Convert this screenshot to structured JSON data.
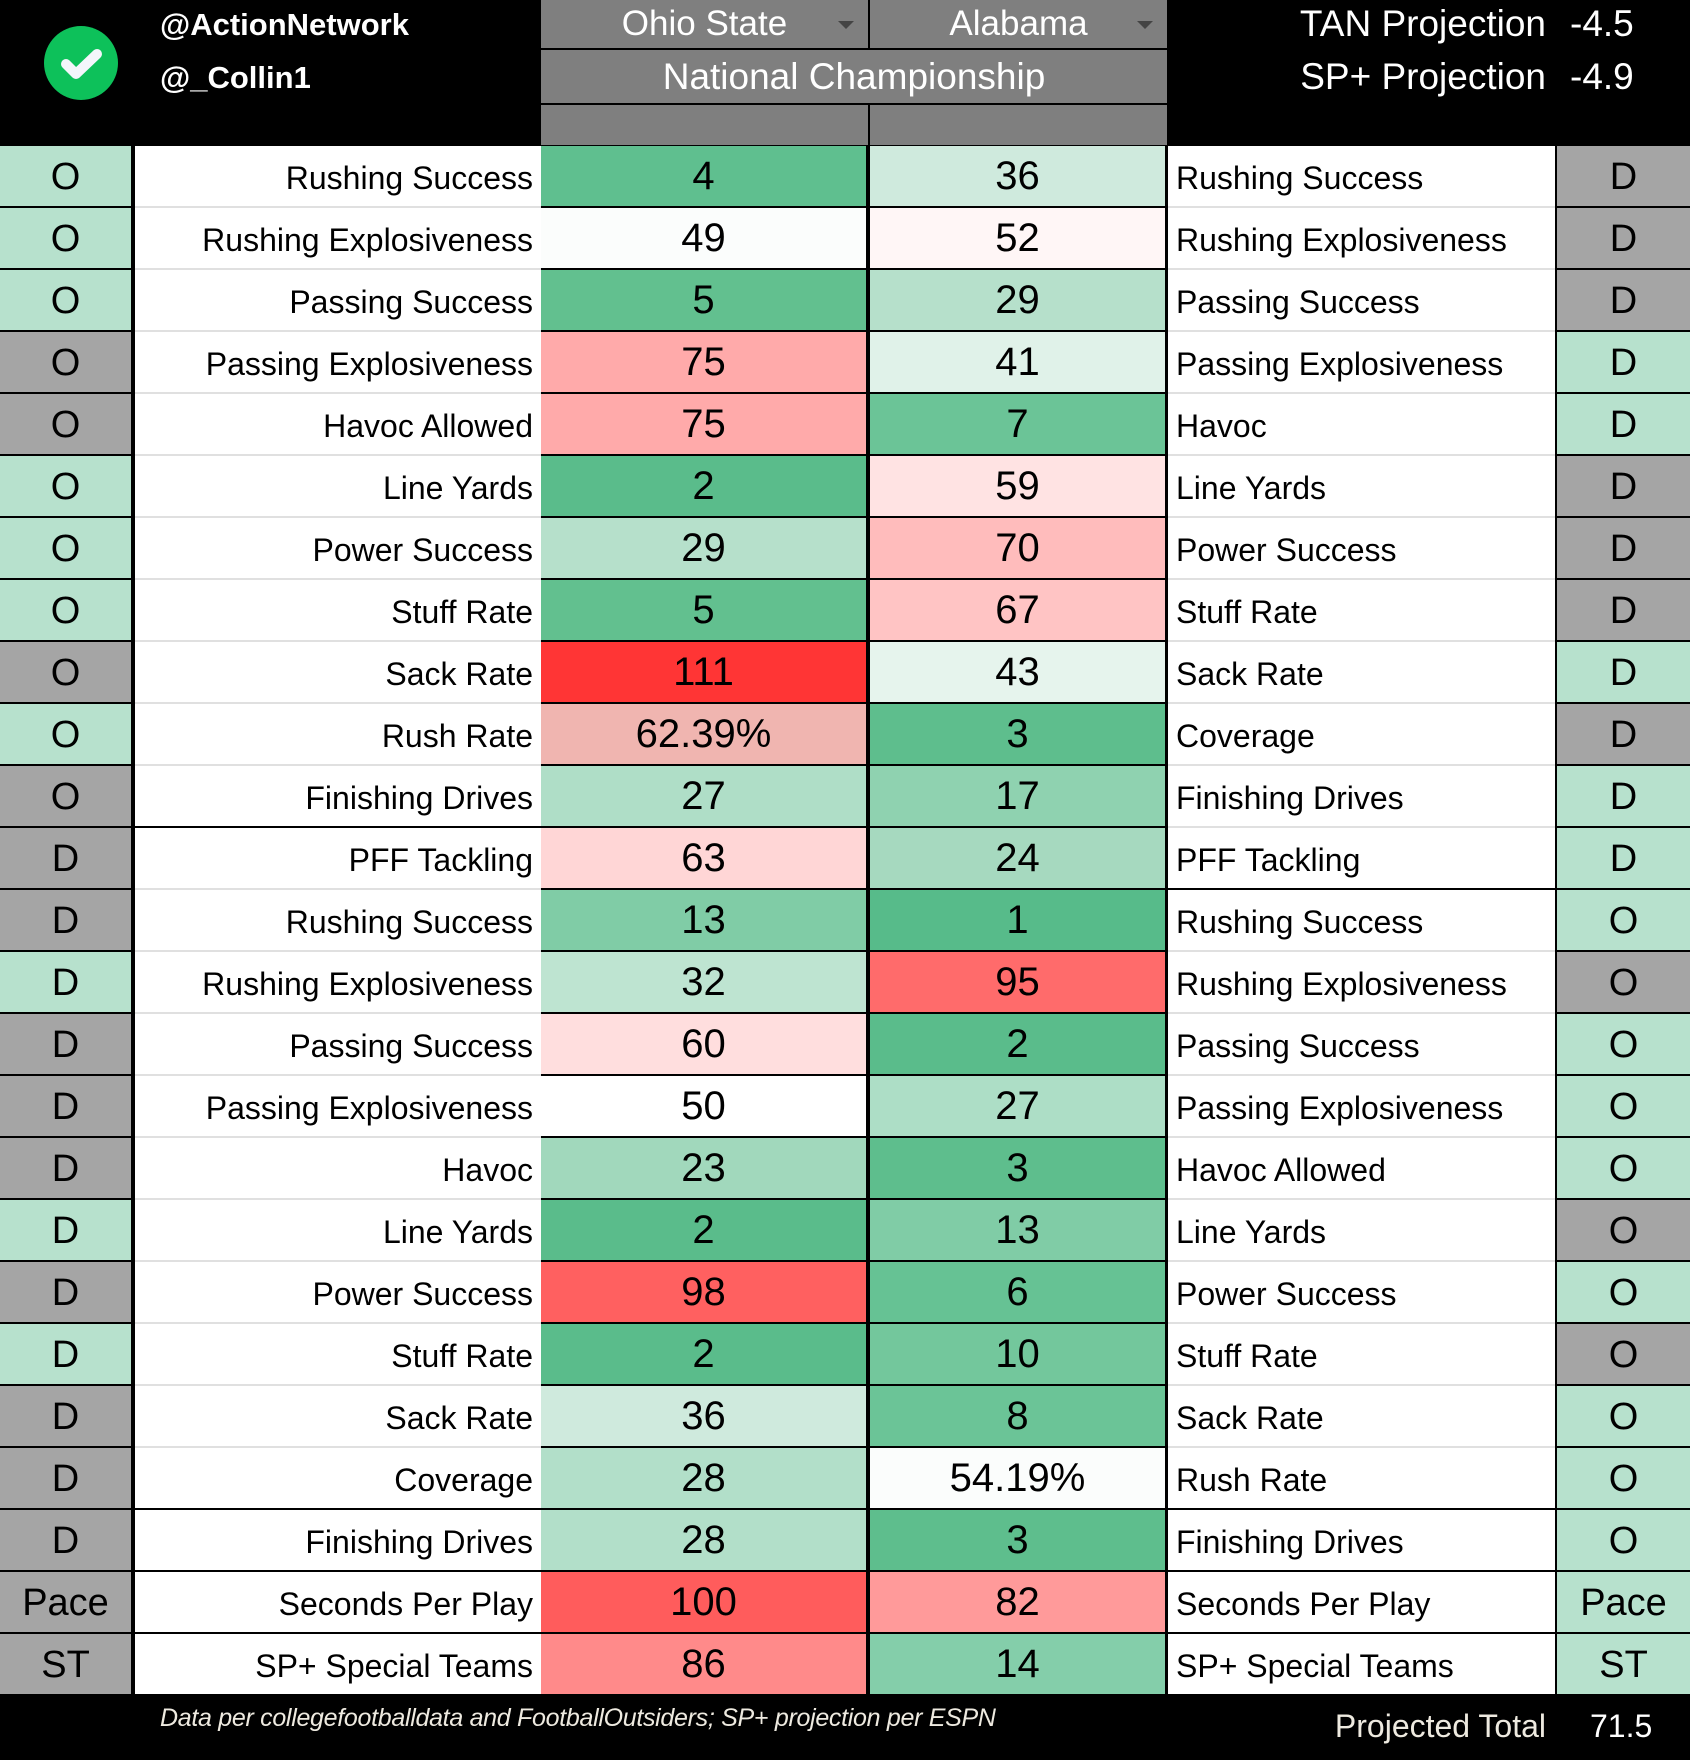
{
  "header": {
    "handles": [
      "@ActionNetwork",
      "@_Collin1"
    ],
    "badge_icon": "check-circle-icon",
    "team_a": "Ohio State",
    "team_b": "Alabama",
    "game": "National Championship",
    "projections": [
      {
        "label": "TAN Projection",
        "value": "-4.5"
      },
      {
        "label": "SP+ Projection",
        "value": "-4.9"
      }
    ]
  },
  "colors": {
    "side_green": "#b7e1cd",
    "side_gray": "#a5a5a5",
    "header_gray": "#7f7f7f",
    "badge_green": "#0dc15a"
  },
  "rows": [
    {
      "ls": "O",
      "lsc": "g",
      "lm": "Rushing Success",
      "a": "4",
      "ac": "#5fbf8f",
      "b": "36",
      "bc": "#cfeadd",
      "rm": "Rushing Success",
      "rs": "D",
      "rsc": "x"
    },
    {
      "ls": "O",
      "lsc": "g",
      "lm": "Rushing Explosiveness",
      "a": "49",
      "ac": "#fbfdfc",
      "b": "52",
      "bc": "#fff6f6",
      "rm": "Rushing Explosiveness",
      "rs": "D",
      "rsc": "x"
    },
    {
      "ls": "O",
      "lsc": "g",
      "lm": "Passing Success",
      "a": "5",
      "ac": "#62c08f",
      "b": "29",
      "bc": "#b6e0cb",
      "rm": "Passing Success",
      "rs": "D",
      "rsc": "x"
    },
    {
      "ls": "O",
      "lsc": "x",
      "lm": "Passing Explosiveness",
      "a": "75",
      "ac": "#ffaaaa",
      "b": "41",
      "bc": "#e0f2e9",
      "rm": "Passing Explosiveness",
      "rs": "D",
      "rsc": "g"
    },
    {
      "ls": "O",
      "lsc": "x",
      "lm": "Havoc Allowed",
      "a": "75",
      "ac": "#ffaaaa",
      "b": "7",
      "bc": "#6bc497",
      "rm": "Havoc",
      "rs": "D",
      "rsc": "g"
    },
    {
      "ls": "O",
      "lsc": "g",
      "lm": "Line Yards",
      "a": "2",
      "ac": "#5abc8b",
      "b": "59",
      "bc": "#ffe3e3",
      "rm": "Line Yards",
      "rs": "D",
      "rsc": "x"
    },
    {
      "ls": "O",
      "lsc": "g",
      "lm": "Power Success",
      "a": "29",
      "ac": "#b6e0cb",
      "b": "70",
      "bc": "#ffbcbc",
      "rm": "Power Success",
      "rs": "D",
      "rsc": "x"
    },
    {
      "ls": "O",
      "lsc": "g",
      "lm": "Stuff Rate",
      "a": "5",
      "ac": "#62c08f",
      "b": "67",
      "bc": "#ffc4c4",
      "rm": "Stuff Rate",
      "rs": "D",
      "rsc": "x"
    },
    {
      "ls": "O",
      "lsc": "x",
      "lm": "Sack Rate",
      "a": "111",
      "ac": "#ff3535",
      "b": "43",
      "bc": "#e6f4ed",
      "rm": "Sack Rate",
      "rs": "D",
      "rsc": "g"
    },
    {
      "ls": "O",
      "lsc": "g",
      "lm": "Rush Rate",
      "a": "62.39%",
      "ac": "#f0b5b0",
      "b": "3",
      "bc": "#5ebe8d",
      "rm": "Coverage",
      "rs": "D",
      "rsc": "x"
    },
    {
      "ls": "O",
      "lsc": "x",
      "lm": "Finishing Drives",
      "a": "27",
      "ac": "#afdec7",
      "b": "17",
      "bc": "#8fd2b0",
      "rm": "Finishing Drives",
      "rs": "D",
      "rsc": "g"
    },
    {
      "ls": "D",
      "lsc": "x",
      "lm": "PFF Tackling",
      "a": "63",
      "ac": "#ffd6d6",
      "b": "24",
      "bc": "#a6d9bf",
      "rm": "PFF Tackling",
      "rs": "D",
      "rsc": "g"
    },
    {
      "ls": "D",
      "lsc": "x",
      "lm": "Rushing Success",
      "a": "13",
      "ac": "#80cca6",
      "b": "1",
      "bc": "#57bb8a",
      "rm": "Rushing Success",
      "rs": "O",
      "rsc": "g"
    },
    {
      "ls": "D",
      "lsc": "g",
      "lm": "Rushing Explosiveness",
      "a": "32",
      "ac": "#bee4d1",
      "b": "95",
      "bc": "#ff6b6b",
      "rm": "Rushing Explosiveness",
      "rs": "O",
      "rsc": "x"
    },
    {
      "ls": "D",
      "lsc": "x",
      "lm": "Passing Success",
      "a": "60",
      "ac": "#ffdede",
      "b": "2",
      "bc": "#5abc8b",
      "rm": "Passing Success",
      "rs": "O",
      "rsc": "g"
    },
    {
      "ls": "D",
      "lsc": "x",
      "lm": "Passing Explosiveness",
      "a": "50",
      "ac": "#ffffff",
      "b": "27",
      "bc": "#addec6",
      "rm": "Passing Explosiveness",
      "rs": "O",
      "rsc": "g"
    },
    {
      "ls": "D",
      "lsc": "x",
      "lm": "Havoc",
      "a": "23",
      "ac": "#a1d8bc",
      "b": "3",
      "bc": "#5ebe8d",
      "rm": "Havoc Allowed",
      "rs": "O",
      "rsc": "g"
    },
    {
      "ls": "D",
      "lsc": "g",
      "lm": "Line Yards",
      "a": "2",
      "ac": "#5abc8b",
      "b": "13",
      "bc": "#80cca6",
      "rm": "Line Yards",
      "rs": "O",
      "rsc": "x"
    },
    {
      "ls": "D",
      "lsc": "x",
      "lm": "Power Success",
      "a": "98",
      "ac": "#ff6060",
      "b": "6",
      "bc": "#66c294",
      "rm": "Power Success",
      "rs": "O",
      "rsc": "g"
    },
    {
      "ls": "D",
      "lsc": "g",
      "lm": "Stuff Rate",
      "a": "2",
      "ac": "#5abc8b",
      "b": "10",
      "bc": "#73c79c",
      "rm": "Stuff Rate",
      "rs": "O",
      "rsc": "x"
    },
    {
      "ls": "D",
      "lsc": "x",
      "lm": "Sack Rate",
      "a": "36",
      "ac": "#cfeadd",
      "b": "8",
      "bc": "#6bc497",
      "rm": "Sack Rate",
      "rs": "O",
      "rsc": "g"
    },
    {
      "ls": "D",
      "lsc": "x",
      "lm": "Coverage",
      "a": "28",
      "ac": "#b2dfc9",
      "b": "54.19%",
      "bc": "#fbfdfc",
      "rm": "Rush Rate",
      "rs": "O",
      "rsc": "g"
    },
    {
      "ls": "D",
      "lsc": "x",
      "lm": "Finishing Drives",
      "a": "28",
      "ac": "#b2dfc9",
      "b": "3",
      "bc": "#5ebe8d",
      "rm": "Finishing Drives",
      "rs": "O",
      "rsc": "g"
    },
    {
      "ls": "Pace",
      "lsc": "x",
      "lm": "Seconds Per Play",
      "a": "100",
      "ac": "#ff5c5c",
      "b": "82",
      "bc": "#ff9a9a",
      "rm": "Seconds Per Play",
      "rs": "Pace",
      "rsc": "g"
    },
    {
      "ls": "ST",
      "lsc": "x",
      "lm": "SP+ Special Teams",
      "a": "86",
      "ac": "#ff8a8a",
      "b": "14",
      "bc": "#84ceaa",
      "rm": "SP+ Special Teams",
      "rs": "ST",
      "rsc": "g"
    }
  ],
  "footer": {
    "note": "Data per collegefootballdata and FootballOutsiders; SP+ projection per ESPN",
    "total_label": "Projected Total",
    "total_value": "71.5"
  }
}
